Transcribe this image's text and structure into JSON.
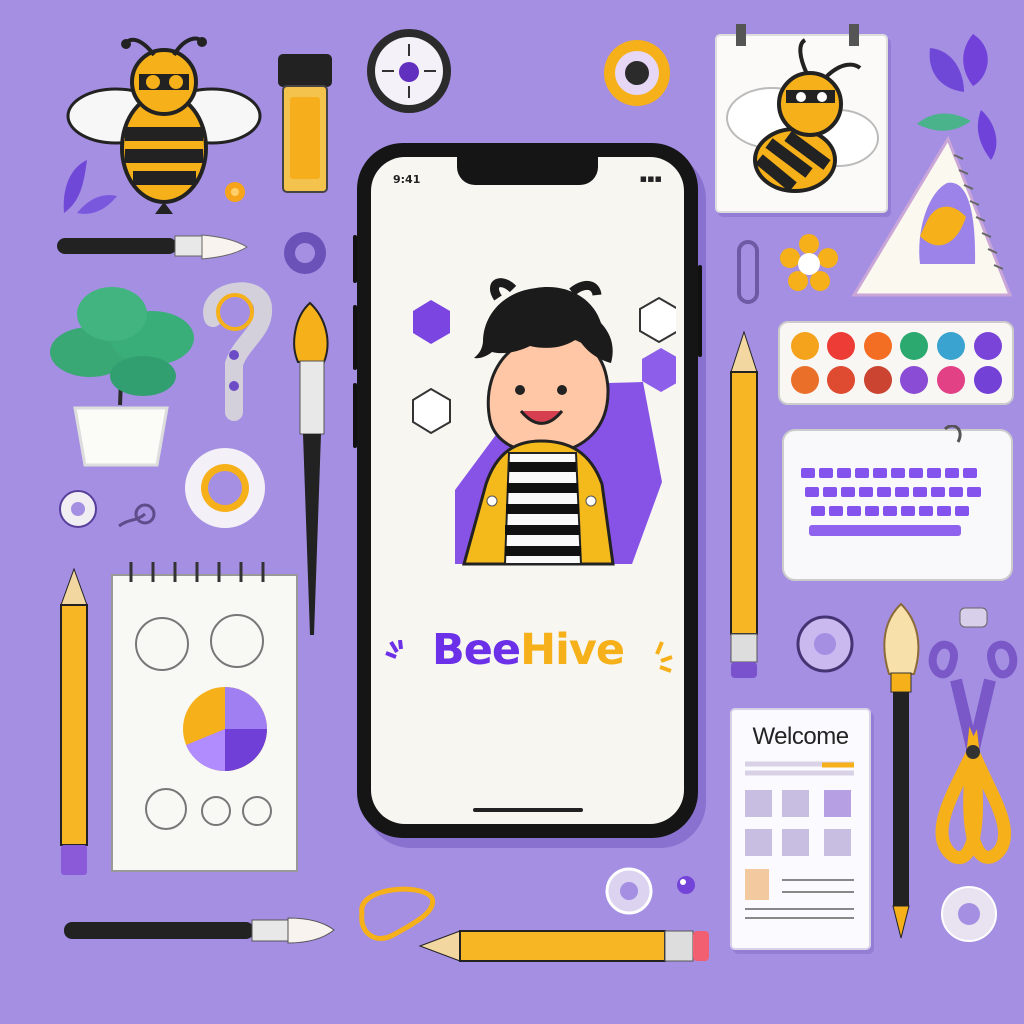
{
  "app": {
    "brand_part1": "Bee",
    "brand_part2": "Hive"
  },
  "phone": {
    "status_left": "9:41",
    "status_right": "▪▪▪"
  },
  "welcome_card": {
    "title": "Welcome"
  },
  "colors": {
    "background": "#a48fe3",
    "brand_purple": "#6b30e7",
    "brand_yellow": "#f6b019",
    "phone_frame": "#151515",
    "screen": "#f7f6f1"
  },
  "icons": [
    "bee-icon",
    "bee-note-icon",
    "ruler-triangle-icon",
    "leaf-icon",
    "plant-pot-icon",
    "paint-brush-icon",
    "pencil-icon",
    "watercolor-palette-icon",
    "keyboard-icon",
    "notebook-icon",
    "scissors-icon",
    "paper-clip-icon",
    "tape-roll-icon",
    "clock-icon"
  ]
}
